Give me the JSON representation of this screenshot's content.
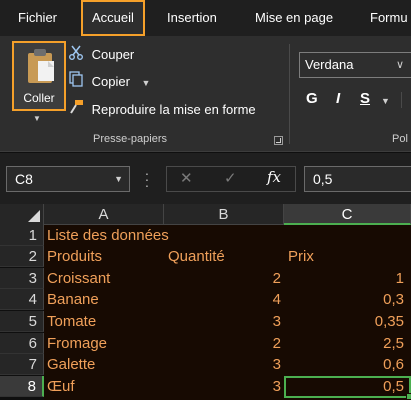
{
  "tabs": [
    "Fichier",
    "Accueil",
    "Insertion",
    "Mise en page",
    "Formu"
  ],
  "active_tab": "Accueil",
  "clipboard": {
    "paste_label": "Coller",
    "cut_label": "Couper",
    "copy_label": "Copier",
    "format_painter_label": "Reproduire la mise en forme",
    "group_label": "Presse-papiers"
  },
  "font": {
    "name": "Verdana",
    "bold": "G",
    "italic": "I",
    "underline": "S",
    "group_label_partial": "Pol"
  },
  "formula_bar": {
    "name_box": "C8",
    "content": "0,5",
    "fx": "fx"
  },
  "grid": {
    "columns": [
      "A",
      "B",
      "C"
    ],
    "selected_column": "C",
    "rows": [
      "1",
      "2",
      "3",
      "4",
      "5",
      "6",
      "7",
      "8"
    ],
    "selected_row": "8",
    "data": [
      [
        "Liste des données",
        "",
        ""
      ],
      [
        "Produits",
        "Quantité",
        "Prix"
      ],
      [
        "Croissant",
        "2",
        "1"
      ],
      [
        "Banane",
        "4",
        "0,3"
      ],
      [
        "Tomate",
        "3",
        "0,35"
      ],
      [
        "Fromage",
        "2",
        "2,5"
      ],
      [
        "Galette",
        "3",
        "0,6"
      ],
      [
        "Œuf",
        "3",
        "0,5"
      ]
    ]
  },
  "colors": {
    "accent_highlight": "#f5a02a",
    "selection": "#4caf50",
    "cell_text": "#f0a05a",
    "cell_background": "#170a02"
  }
}
